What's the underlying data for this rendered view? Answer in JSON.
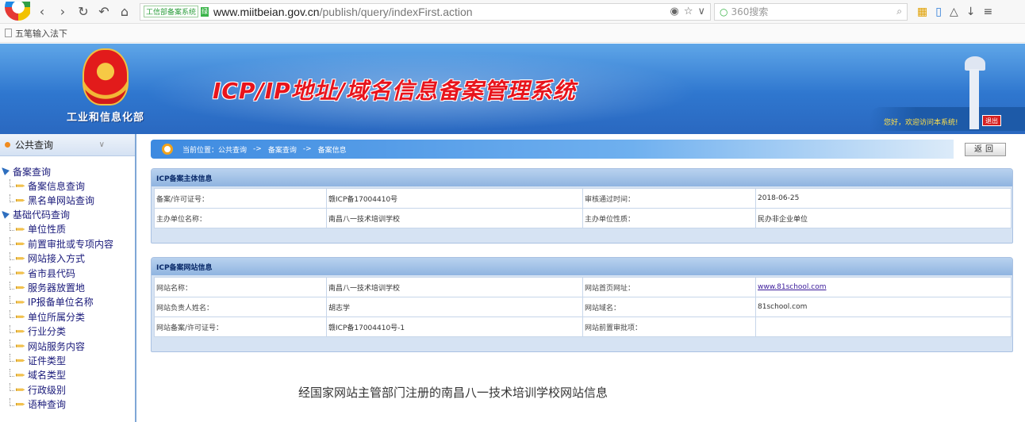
{
  "browser": {
    "site_badge": "工信部备案系统",
    "green_badge": "绿",
    "url_host": "www.miitbeian.gov.cn",
    "url_path": "/publish/query/indexFirst.action",
    "search_placeholder": "360搜索",
    "bookmark": "五笔输入法下"
  },
  "banner": {
    "ministry": "工业和信息化部",
    "title": "ICP/IP地址/域名信息备案管理系统",
    "welcome": "您好，欢迎访问本系统!",
    "logout": "退出"
  },
  "sidebar": {
    "header": "公共查询",
    "groups": [
      {
        "label": "备案查询",
        "items": [
          "备案信息查询",
          "黑名单网站查询"
        ]
      },
      {
        "label": "基础代码查询",
        "items": [
          "单位性质",
          "前置审批或专项内容",
          "网站接入方式",
          "省市县代码",
          "服务器放置地",
          "IP报备单位名称",
          "单位所属分类",
          "行业分类",
          "网站服务内容",
          "证件类型",
          "域名类型",
          "行政级别",
          "语种查询"
        ]
      }
    ]
  },
  "main": {
    "breadcrumb": [
      "当前位置：公共查询",
      "->",
      "备案查询",
      "->",
      "备案信息"
    ],
    "back_button": "返回",
    "subject_panel": {
      "title": "ICP备案主体信息",
      "rows": [
        [
          "备案/许可证号：",
          "赣ICP备17004410号",
          "审核通过时间：",
          "2018-06-25"
        ],
        [
          "主办单位名称：",
          "南昌八一技术培训学校",
          "主办单位性质：",
          "民办非企业单位"
        ]
      ]
    },
    "website_panel": {
      "title": "ICP备案网站信息",
      "rows": [
        [
          "网站名称：",
          "南昌八一技术培训学校",
          "网站首页网址：",
          "www.81school.com"
        ],
        [
          "网站负责人姓名：",
          "胡志学",
          "网站域名：",
          "81school.com"
        ],
        [
          "网站备案/许可证号：",
          "赣ICP备17004410号-1",
          "网站前置审批项：",
          ""
        ]
      ]
    },
    "footer_note": "经国家网站主管部门注册的南昌八一技术培训学校网站信息"
  }
}
